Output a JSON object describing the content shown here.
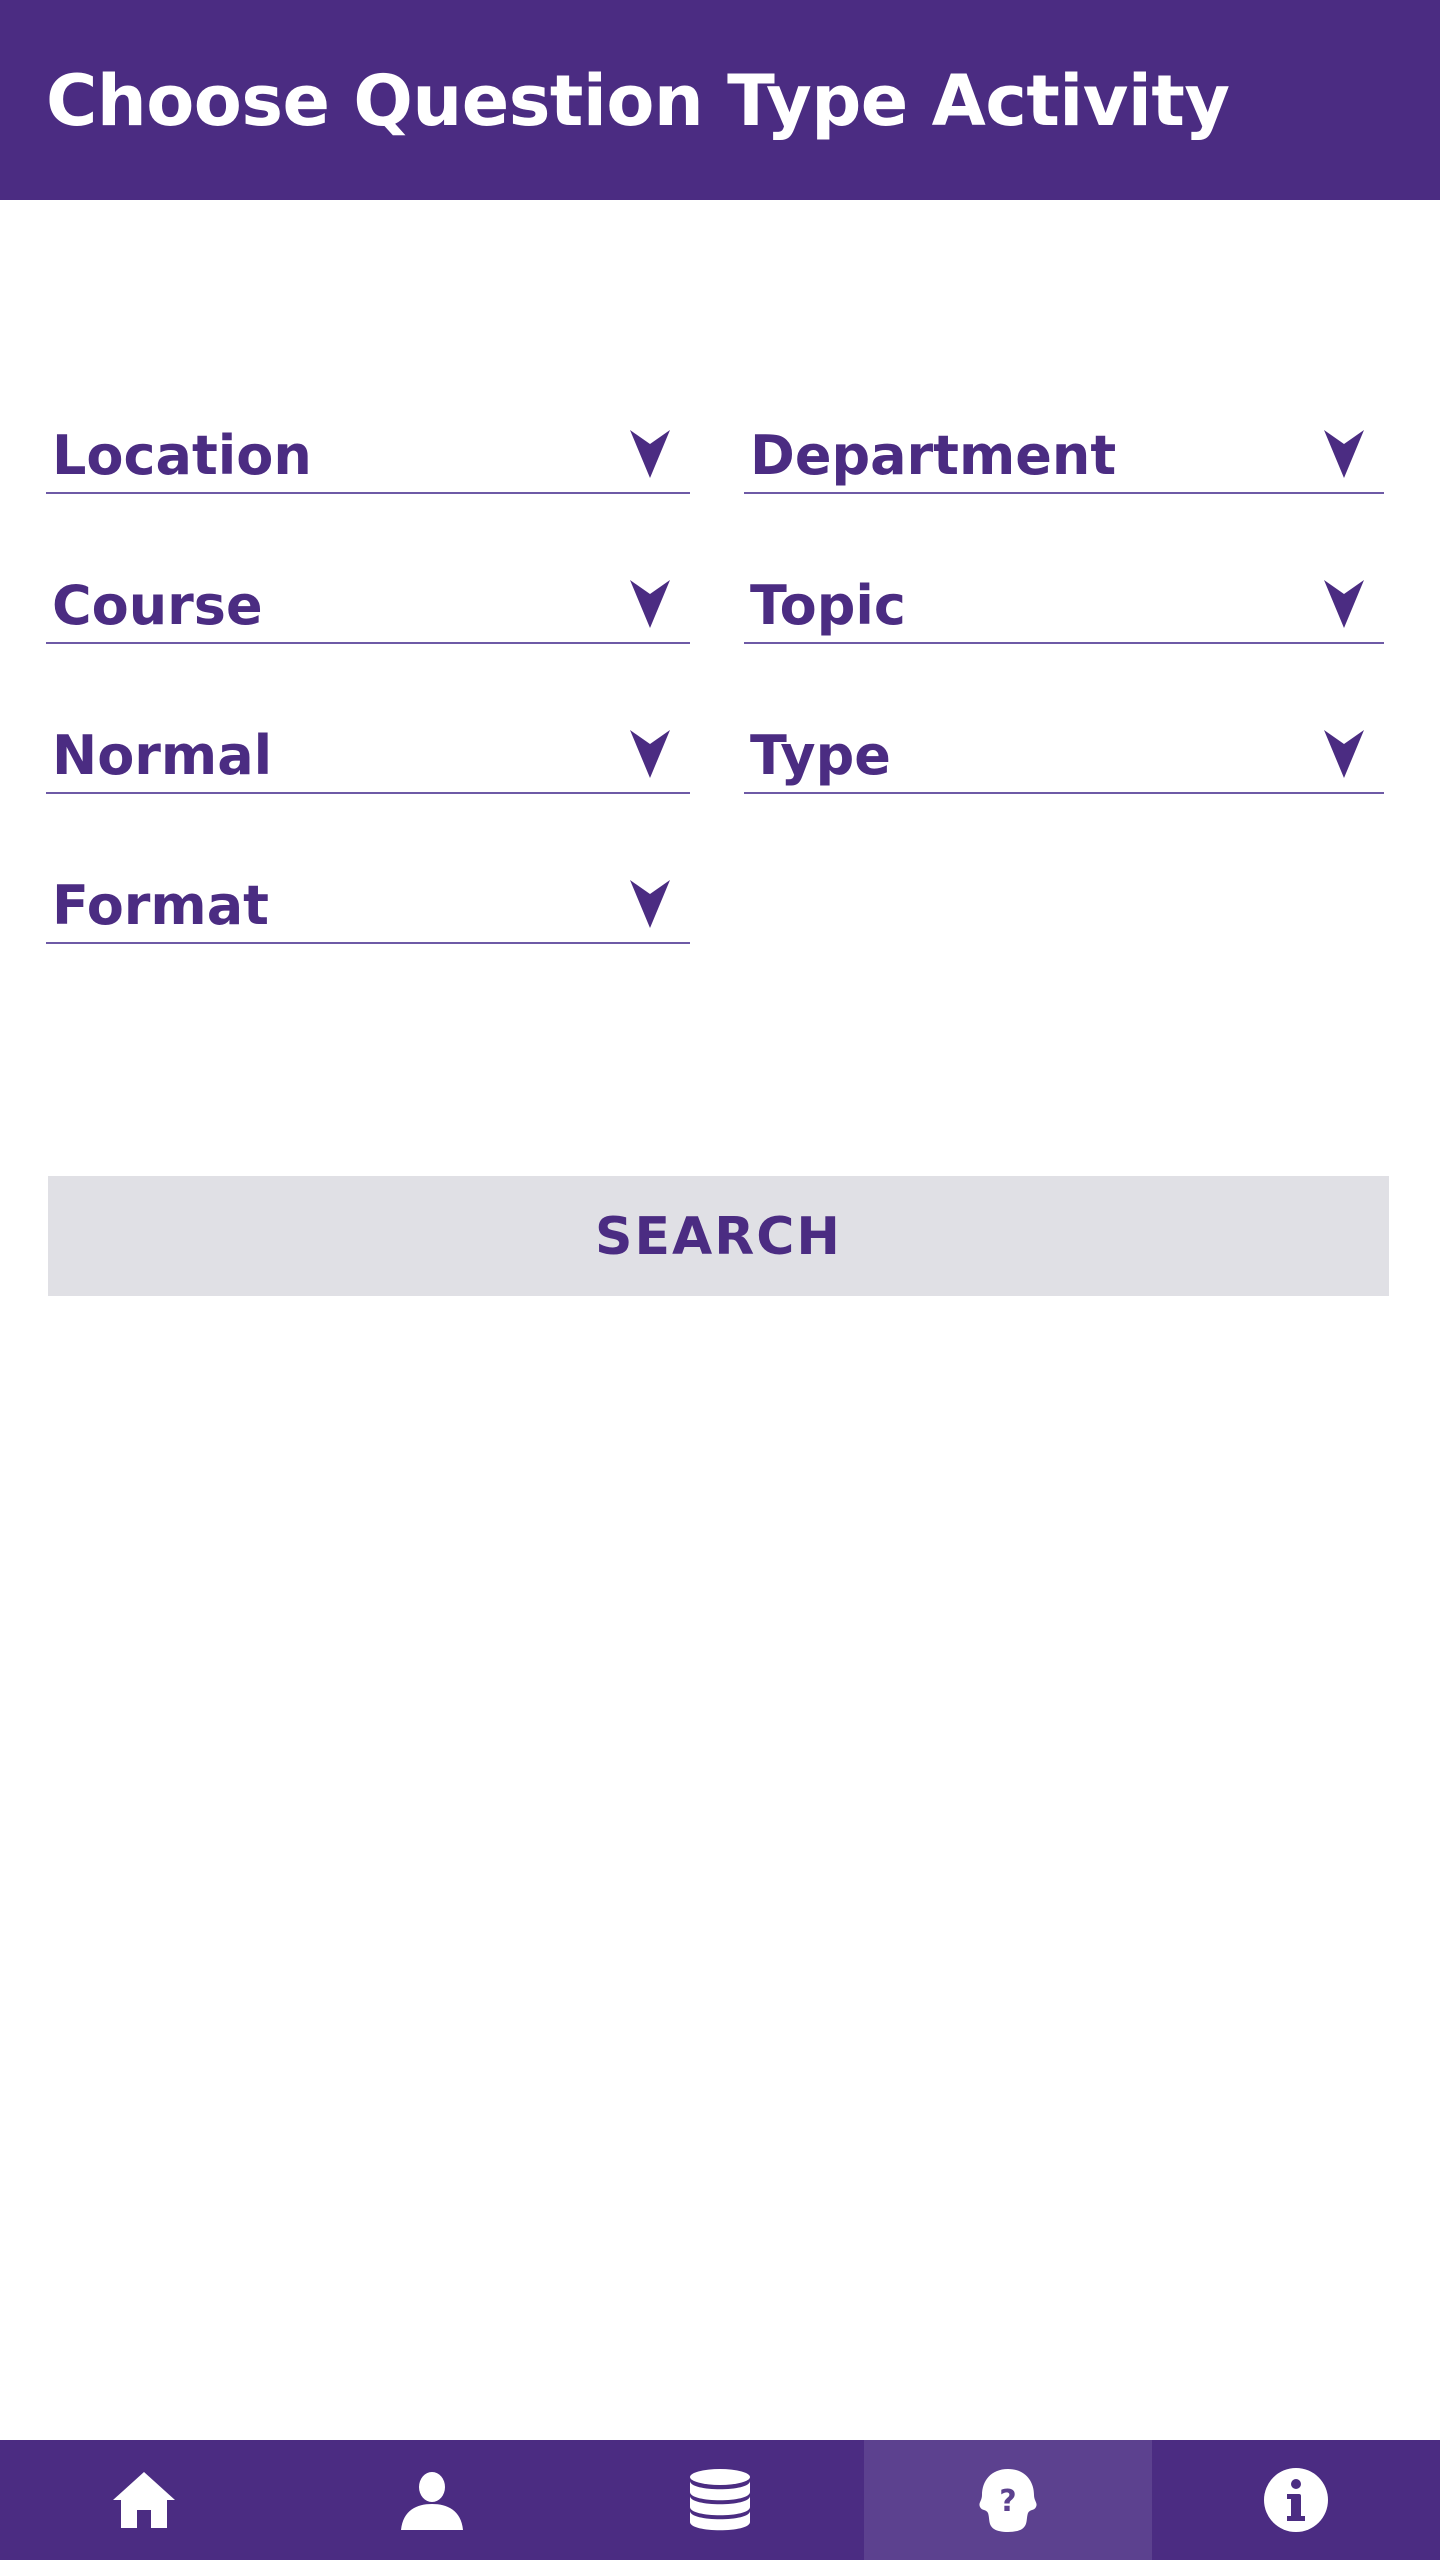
{
  "header": {
    "title": "Choose Question Type Activity"
  },
  "filters": {
    "location": "Location",
    "department": "Department",
    "course": "Course",
    "topic": "Topic",
    "normal": "Normal",
    "type": "Type",
    "format": "Format"
  },
  "search": {
    "label": "SEARCH"
  },
  "nav": {
    "items": [
      {
        "icon": "home-icon"
      },
      {
        "icon": "user-icon"
      },
      {
        "icon": "database-icon"
      },
      {
        "icon": "question-head-icon",
        "active": true
      },
      {
        "icon": "info-icon"
      }
    ]
  },
  "colors": {
    "primary": "#4b2c82",
    "nav_active": "#5c418f",
    "button_bg": "#e0e0e5",
    "underline": "#6e5aa6"
  }
}
